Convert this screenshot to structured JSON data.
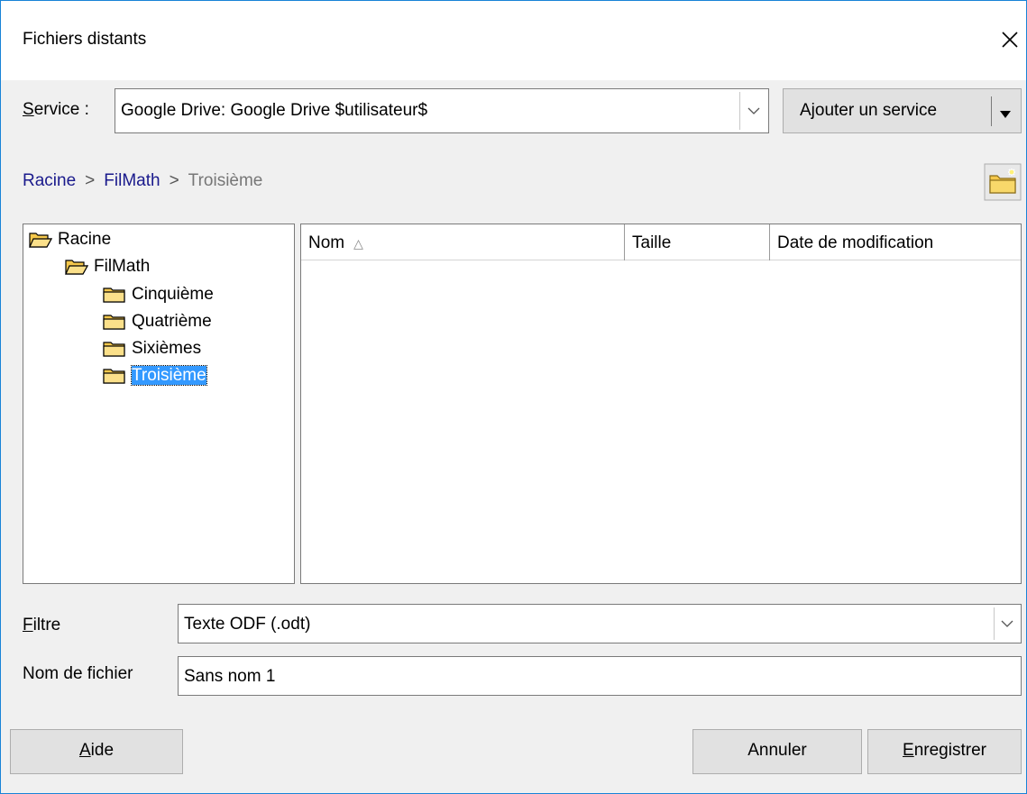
{
  "window": {
    "title": "Fichiers distants"
  },
  "service": {
    "label_accel": "S",
    "label_rest": "ervice :",
    "value": "Google Drive: Google Drive $utilisateur$",
    "add_button_label": "Ajouter un service"
  },
  "breadcrumb": {
    "items": [
      {
        "label": "Racine"
      },
      {
        "label": "FilMath"
      },
      {
        "label": "Troisième"
      }
    ],
    "separator": ">"
  },
  "tree": {
    "items": [
      {
        "label": "Racine",
        "icon": "folder-open-icon",
        "level": 0
      },
      {
        "label": "FilMath",
        "icon": "folder-open-icon",
        "level": 1
      },
      {
        "label": "Cinquième",
        "icon": "folder-icon",
        "level": 2
      },
      {
        "label": "Quatrième",
        "icon": "folder-icon",
        "level": 2
      },
      {
        "label": "Sixièmes",
        "icon": "folder-icon",
        "level": 2
      },
      {
        "label": "Troisième",
        "icon": "folder-icon",
        "level": 2,
        "selected": true
      }
    ]
  },
  "file_list": {
    "columns": [
      "Nom",
      "Taille",
      "Date de modification"
    ],
    "sort_column": "Nom",
    "sort_direction": "ascending",
    "rows": []
  },
  "filter": {
    "label_accel": "F",
    "label_rest": "iltre",
    "value": "Texte ODF (.odt)"
  },
  "filename": {
    "label": "Nom de fichier",
    "value": "Sans nom 1"
  },
  "buttons": {
    "help_accel": "A",
    "help_rest": "ide",
    "cancel": "Annuler",
    "save_accel": "E",
    "save_rest": "nregistrer"
  },
  "colors": {
    "window_border": "#1883d7",
    "selection": "#3399ff",
    "link": "#1a1a8c",
    "folder": "#f5c84c"
  }
}
